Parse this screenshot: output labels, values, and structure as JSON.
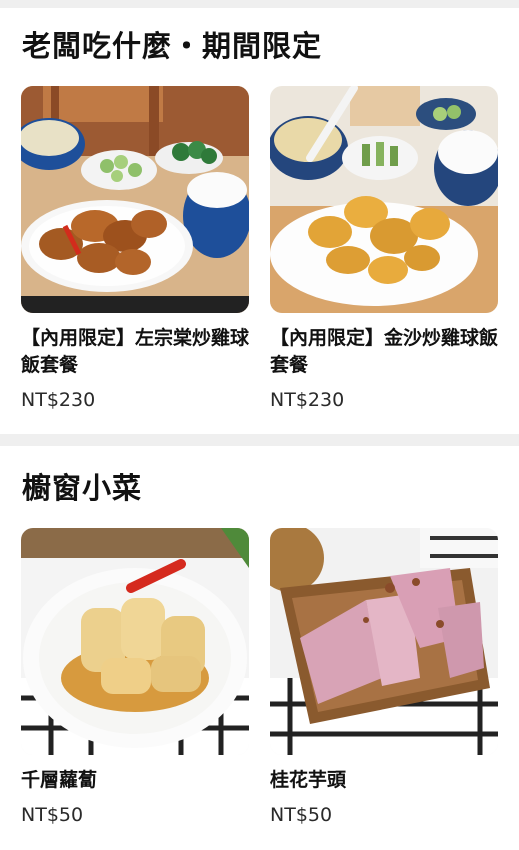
{
  "sections": [
    {
      "title": "老闆吃什麼・期間限定",
      "items": [
        {
          "name": "【內用限定】左宗棠炒雞球飯套餐",
          "price": "NT$230",
          "image": "general-tso-chicken-set-photo"
        },
        {
          "name": "【內用限定】金沙炒雞球飯套餐",
          "price": "NT$230",
          "image": "golden-sand-chicken-set-photo"
        }
      ]
    },
    {
      "title": "櫥窗小菜",
      "items": [
        {
          "name": "千層蘿蔔",
          "price": "NT$50",
          "image": "layered-radish-photo"
        },
        {
          "name": "桂花芋頭",
          "price": "NT$50",
          "image": "osmanthus-taro-photo"
        }
      ]
    }
  ]
}
